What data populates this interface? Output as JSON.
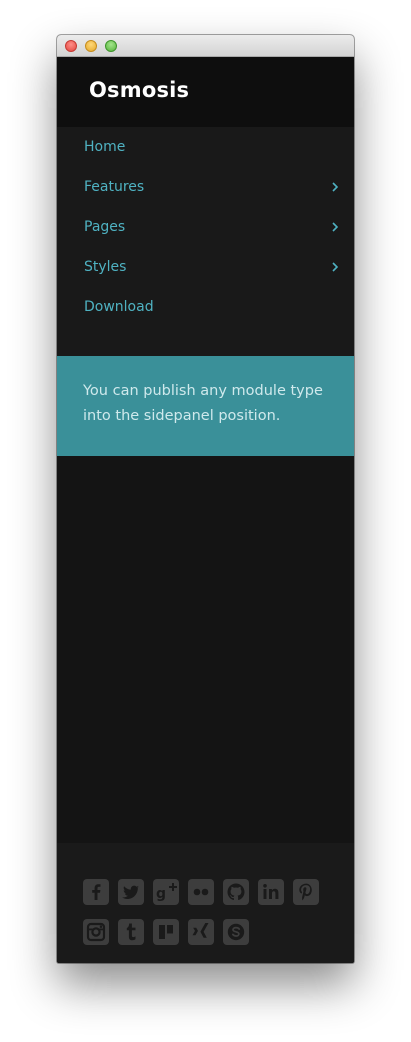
{
  "app": {
    "logo": "Osmosis"
  },
  "nav": {
    "items": [
      {
        "label": "Home",
        "has_submenu": false
      },
      {
        "label": "Features",
        "has_submenu": true
      },
      {
        "label": "Pages",
        "has_submenu": true
      },
      {
        "label": "Styles",
        "has_submenu": true
      },
      {
        "label": "Download",
        "has_submenu": false
      }
    ]
  },
  "module": {
    "text": "You can publish any module type into the sidepanel position."
  },
  "footer": {
    "social_icons": [
      "facebook-icon",
      "twitter-icon",
      "google-plus-icon",
      "flickr-icon",
      "github-icon",
      "linkedin-icon",
      "pinterest-icon",
      "instagram-icon",
      "tumblr-icon",
      "trello-icon",
      "xing-icon",
      "skype-icon"
    ]
  },
  "colors": {
    "accent": "#4fb2c2",
    "module_bg": "#3a9099",
    "panel_bg": "#151515",
    "icon": "#3d3d3d"
  }
}
